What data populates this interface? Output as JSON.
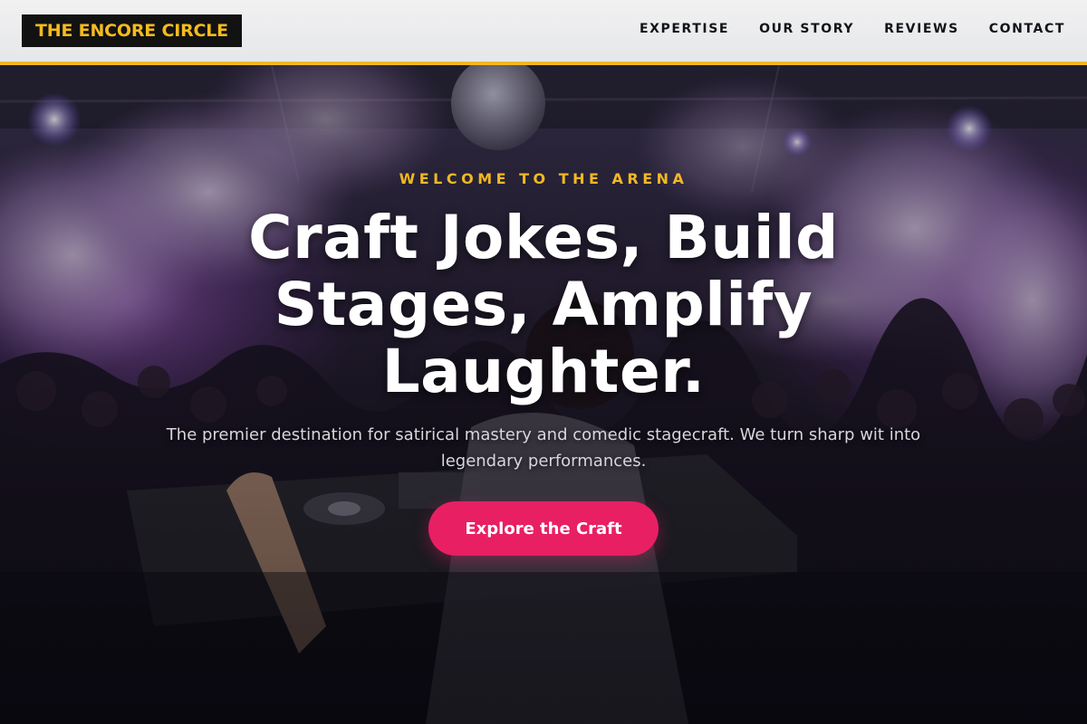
{
  "header": {
    "logo": "THE ENCORE CIRCLE",
    "nav": [
      "EXPERTISE",
      "OUR STORY",
      "REVIEWS",
      "CONTACT"
    ]
  },
  "hero": {
    "eyebrow": "WELCOME TO THE ARENA",
    "headline": "Craft Jokes, Build Stages, Amplify Laughter.",
    "subtext": "The premier destination for satirical mastery and comedic stagecraft. We turn sharp wit into legendary performances.",
    "cta": "Explore the Craft",
    "background": "concert crowd with DJ booth, stage lights and smoke"
  },
  "colors": {
    "accent": "#f2b824",
    "cta": "#e81f63",
    "logo_bg": "#121212",
    "header_bg": "#ececed"
  }
}
